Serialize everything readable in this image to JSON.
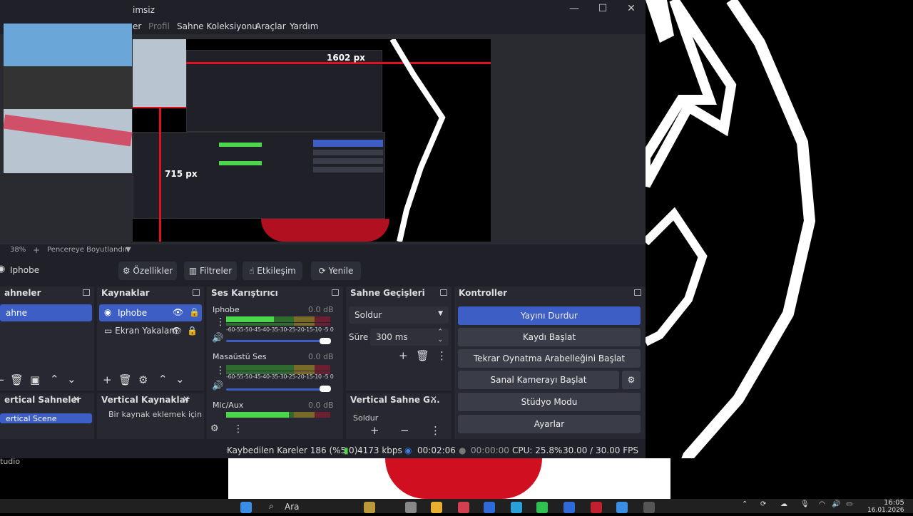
{
  "window": {
    "title": "imsiz"
  },
  "menu": [
    "er",
    "Profil",
    "Sahne Koleksiyonu",
    "Araçlar",
    "Yardım"
  ],
  "preview": {
    "measure_width": "1602 px",
    "measure_height": "715 px"
  },
  "zoom": {
    "value": "38%",
    "plus": "+",
    "label": "Pencereye Boyutlandır",
    "chevron": "▼"
  },
  "source_bar": {
    "name": "Iphobe",
    "buttons": [
      "Özellikler",
      "Filtreler",
      "Etkileşim",
      "Yenile"
    ]
  },
  "docks": {
    "scenes": {
      "title": "ahneler",
      "selected": "ahne"
    },
    "sources": {
      "title": "Kaynaklar",
      "items": [
        "Iphobe",
        "Ekran Yakalam"
      ]
    },
    "mixer": {
      "title": "Ses Karıştırıcı",
      "scale": "-60-55-50-45-40-35-30-25-20-15-10 -5 0",
      "channels": [
        {
          "name": "Iphobe",
          "db": "0.0 dB",
          "level": 0.46
        },
        {
          "name": "Masaüstü Ses",
          "db": "0.0 dB",
          "level": 0.02
        },
        {
          "name": "Mic/Aux",
          "db": "0.0 dB",
          "level": 0.6
        }
      ]
    },
    "transitions": {
      "title": "Sahne Geçişleri",
      "type": "Soldur",
      "duration_label": "Süre",
      "duration": "300 ms"
    },
    "controls": {
      "title": "Kontroller",
      "buttons": [
        "Yayını Durdur",
        "Kaydı Başlat",
        "Tekrar Oynatma Arabelleğini Başlat",
        "Sanal Kamerayı Başlat",
        "Stüdyo Modu",
        "Ayarlar"
      ]
    },
    "vertical_scenes": {
      "title": "ertical Sahneler",
      "selected": "ertical Scene"
    },
    "vertical_sources": {
      "title": "Vertical Kaynaklar",
      "hint": "Bir kaynak eklemek için"
    },
    "vertical_transitions": {
      "title": "Vertical Sahne G...",
      "type": "Soldur"
    }
  },
  "status": {
    "dropped": "Kaybedilen Kareler 186 (%5.0)",
    "bitrate": "4173 kbps",
    "stream_time": "00:02:06",
    "rec_time": "00:00:00",
    "cpu": "CPU: 25.8%",
    "fps": "30.00 / 30.00 FPS"
  },
  "bg_caption": "tudio",
  "taskbar": {
    "search": "Ara",
    "time": "16:05",
    "date": "16.01.2026"
  },
  "colors": {
    "accent": "#3c5ec5",
    "panel": "#272831",
    "window": "#1f2028"
  }
}
